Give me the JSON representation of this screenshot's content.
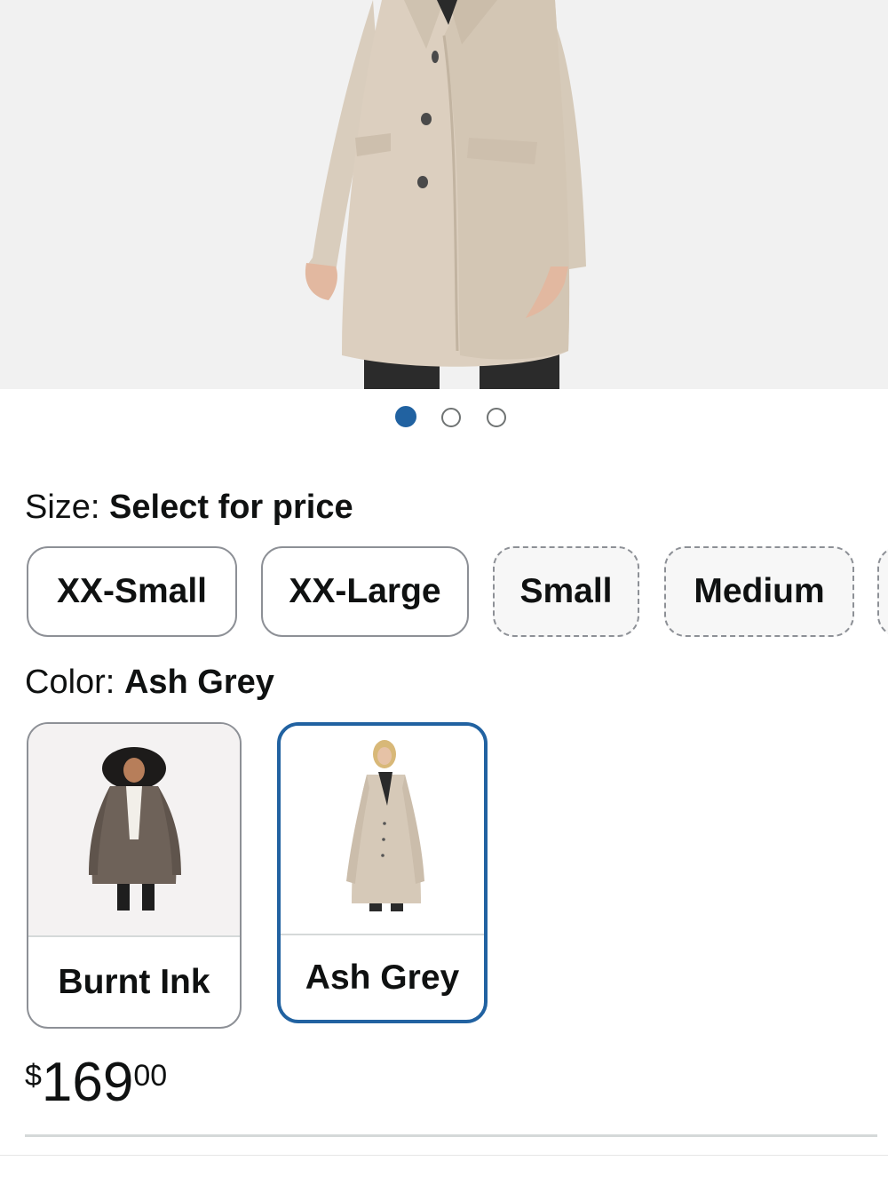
{
  "carousel": {
    "dots": [
      {
        "state": "active"
      },
      {
        "state": "inactive"
      },
      {
        "state": "inactive"
      }
    ]
  },
  "size": {
    "label": "Size:",
    "value": "Select for price",
    "options": [
      {
        "label": "XX-Small",
        "available": true
      },
      {
        "label": "XX-Large",
        "available": true
      },
      {
        "label": "Small",
        "available": false
      },
      {
        "label": "Medium",
        "available": false
      }
    ]
  },
  "color": {
    "label": "Color:",
    "value": "Ash Grey",
    "options": [
      {
        "label": "Burnt Ink",
        "selected": false,
        "swatch": "#6e6259"
      },
      {
        "label": "Ash Grey",
        "selected": true,
        "swatch": "#d6c9b8"
      }
    ]
  },
  "price": {
    "symbol": "$",
    "whole": "169",
    "fraction": "00"
  },
  "colors": {
    "accent": "#2162a1",
    "border": "#8d9096",
    "text": "#0f1111"
  }
}
